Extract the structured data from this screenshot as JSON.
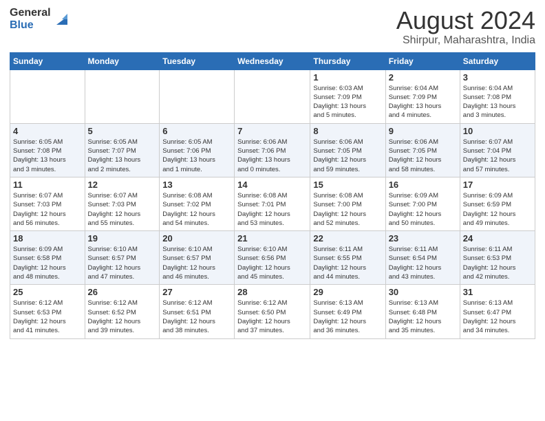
{
  "header": {
    "logo_general": "General",
    "logo_blue": "Blue",
    "title": "August 2024",
    "subtitle": "Shirpur, Maharashtra, India"
  },
  "weekdays": [
    "Sunday",
    "Monday",
    "Tuesday",
    "Wednesday",
    "Thursday",
    "Friday",
    "Saturday"
  ],
  "rows": [
    [
      {
        "day": "",
        "info": ""
      },
      {
        "day": "",
        "info": ""
      },
      {
        "day": "",
        "info": ""
      },
      {
        "day": "",
        "info": ""
      },
      {
        "day": "1",
        "info": "Sunrise: 6:03 AM\nSunset: 7:09 PM\nDaylight: 13 hours\nand 5 minutes."
      },
      {
        "day": "2",
        "info": "Sunrise: 6:04 AM\nSunset: 7:09 PM\nDaylight: 13 hours\nand 4 minutes."
      },
      {
        "day": "3",
        "info": "Sunrise: 6:04 AM\nSunset: 7:08 PM\nDaylight: 13 hours\nand 3 minutes."
      }
    ],
    [
      {
        "day": "4",
        "info": "Sunrise: 6:05 AM\nSunset: 7:08 PM\nDaylight: 13 hours\nand 3 minutes."
      },
      {
        "day": "5",
        "info": "Sunrise: 6:05 AM\nSunset: 7:07 PM\nDaylight: 13 hours\nand 2 minutes."
      },
      {
        "day": "6",
        "info": "Sunrise: 6:05 AM\nSunset: 7:06 PM\nDaylight: 13 hours\nand 1 minute."
      },
      {
        "day": "7",
        "info": "Sunrise: 6:06 AM\nSunset: 7:06 PM\nDaylight: 13 hours\nand 0 minutes."
      },
      {
        "day": "8",
        "info": "Sunrise: 6:06 AM\nSunset: 7:05 PM\nDaylight: 12 hours\nand 59 minutes."
      },
      {
        "day": "9",
        "info": "Sunrise: 6:06 AM\nSunset: 7:05 PM\nDaylight: 12 hours\nand 58 minutes."
      },
      {
        "day": "10",
        "info": "Sunrise: 6:07 AM\nSunset: 7:04 PM\nDaylight: 12 hours\nand 57 minutes."
      }
    ],
    [
      {
        "day": "11",
        "info": "Sunrise: 6:07 AM\nSunset: 7:03 PM\nDaylight: 12 hours\nand 56 minutes."
      },
      {
        "day": "12",
        "info": "Sunrise: 6:07 AM\nSunset: 7:03 PM\nDaylight: 12 hours\nand 55 minutes."
      },
      {
        "day": "13",
        "info": "Sunrise: 6:08 AM\nSunset: 7:02 PM\nDaylight: 12 hours\nand 54 minutes."
      },
      {
        "day": "14",
        "info": "Sunrise: 6:08 AM\nSunset: 7:01 PM\nDaylight: 12 hours\nand 53 minutes."
      },
      {
        "day": "15",
        "info": "Sunrise: 6:08 AM\nSunset: 7:00 PM\nDaylight: 12 hours\nand 52 minutes."
      },
      {
        "day": "16",
        "info": "Sunrise: 6:09 AM\nSunset: 7:00 PM\nDaylight: 12 hours\nand 50 minutes."
      },
      {
        "day": "17",
        "info": "Sunrise: 6:09 AM\nSunset: 6:59 PM\nDaylight: 12 hours\nand 49 minutes."
      }
    ],
    [
      {
        "day": "18",
        "info": "Sunrise: 6:09 AM\nSunset: 6:58 PM\nDaylight: 12 hours\nand 48 minutes."
      },
      {
        "day": "19",
        "info": "Sunrise: 6:10 AM\nSunset: 6:57 PM\nDaylight: 12 hours\nand 47 minutes."
      },
      {
        "day": "20",
        "info": "Sunrise: 6:10 AM\nSunset: 6:57 PM\nDaylight: 12 hours\nand 46 minutes."
      },
      {
        "day": "21",
        "info": "Sunrise: 6:10 AM\nSunset: 6:56 PM\nDaylight: 12 hours\nand 45 minutes."
      },
      {
        "day": "22",
        "info": "Sunrise: 6:11 AM\nSunset: 6:55 PM\nDaylight: 12 hours\nand 44 minutes."
      },
      {
        "day": "23",
        "info": "Sunrise: 6:11 AM\nSunset: 6:54 PM\nDaylight: 12 hours\nand 43 minutes."
      },
      {
        "day": "24",
        "info": "Sunrise: 6:11 AM\nSunset: 6:53 PM\nDaylight: 12 hours\nand 42 minutes."
      }
    ],
    [
      {
        "day": "25",
        "info": "Sunrise: 6:12 AM\nSunset: 6:53 PM\nDaylight: 12 hours\nand 41 minutes."
      },
      {
        "day": "26",
        "info": "Sunrise: 6:12 AM\nSunset: 6:52 PM\nDaylight: 12 hours\nand 39 minutes."
      },
      {
        "day": "27",
        "info": "Sunrise: 6:12 AM\nSunset: 6:51 PM\nDaylight: 12 hours\nand 38 minutes."
      },
      {
        "day": "28",
        "info": "Sunrise: 6:12 AM\nSunset: 6:50 PM\nDaylight: 12 hours\nand 37 minutes."
      },
      {
        "day": "29",
        "info": "Sunrise: 6:13 AM\nSunset: 6:49 PM\nDaylight: 12 hours\nand 36 minutes."
      },
      {
        "day": "30",
        "info": "Sunrise: 6:13 AM\nSunset: 6:48 PM\nDaylight: 12 hours\nand 35 minutes."
      },
      {
        "day": "31",
        "info": "Sunrise: 6:13 AM\nSunset: 6:47 PM\nDaylight: 12 hours\nand 34 minutes."
      }
    ]
  ]
}
